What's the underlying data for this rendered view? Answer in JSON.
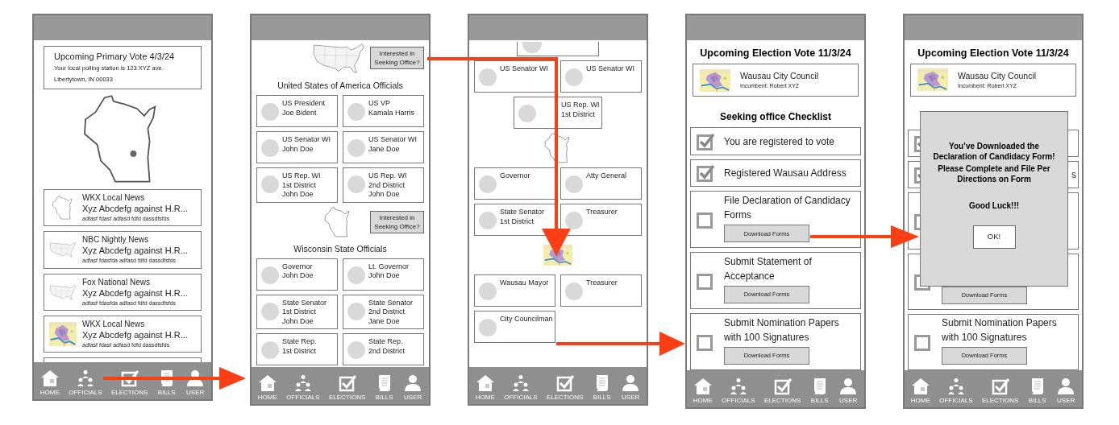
{
  "screens": [
    {
      "kind": "home",
      "blocks": [
        {
          "kind": "notice",
          "title": "Upcoming Primary Vote 4/3/24",
          "lines": [
            "Your local polling station is 123 XYZ ave.",
            "Libertytown, IN 00033"
          ]
        },
        {
          "kind": "state_map",
          "pin": true
        },
        {
          "kind": "state_news",
          "source": "WKX Local News",
          "headline": "Xyz Abcdefg against H.R...",
          "snippet": "adfasf fdasf adfasd fdfd dassdfsfds"
        },
        {
          "kind": "country_news",
          "source": "NBC Nightly News",
          "headline": "Xyz Abcdefg against H.R...",
          "snippet": "adfasf fdasfda adfasd fdfd dassdfsfds"
        },
        {
          "kind": "country_news",
          "source": "Fox National News",
          "headline": "Xyz Abcdefg against H.R...",
          "snippet": "adfasf fdasfda adfasd fdfd dassdfsfds"
        },
        {
          "kind": "city_news",
          "source": "WKX Local News",
          "headline": "Xyz Abcdefg against H.R...",
          "snippet": "adfasf fdasf adfasd fdfd dassdfsfds"
        },
        {
          "kind": "card_edge",
          "avatar": false
        }
      ],
      "nav": [
        "HOME",
        "OFFICIALS",
        "ELECTIONS",
        "BILLS",
        "USER"
      ]
    },
    {
      "kind": "officials",
      "blocks": [
        {
          "kind": "country_map",
          "button": "Interested in Seeking Office?"
        },
        {
          "kind": "heading",
          "text": "United States of America Officials"
        },
        {
          "kind": "officials",
          "cards": [
            {
              "lines": [
                "US President",
                "Joe Bident"
              ]
            },
            {
              "lines": [
                "US VP",
                "Kamala Harris"
              ]
            },
            {
              "lines": [
                "US Senator WI",
                "John Doe"
              ]
            },
            {
              "lines": [
                "US Senator WI",
                "Jane Doe"
              ]
            },
            {
              "lines": [
                "US Rep. WI",
                "1st District",
                "John Doe"
              ]
            },
            {
              "lines": [
                "US Rep. WI",
                "2nd District",
                "John Doe"
              ]
            }
          ]
        },
        {
          "kind": "state_map",
          "button": "Interested in Seeking Office?"
        },
        {
          "kind": "heading",
          "text": "Wisconsin State Officials"
        },
        {
          "kind": "officials",
          "cards": [
            {
              "lines": [
                "Governor",
                "John Doe"
              ]
            },
            {
              "lines": [
                "Lt. Governor",
                "John Doe"
              ]
            },
            {
              "lines": [
                "State Senator",
                "1st District",
                "John Doe"
              ]
            },
            {
              "lines": [
                "State Senator",
                "2nd District",
                "Jane Doe"
              ]
            },
            {
              "lines": [
                "State Rep.",
                "1st District"
              ]
            },
            {
              "lines": [
                "State Rep.",
                "2nd District"
              ]
            }
          ]
        }
      ],
      "nav": [
        "HOME",
        "OFFICIALS",
        "ELECTIONS",
        "BILLS",
        "USER"
      ]
    },
    {
      "kind": "officials",
      "blocks": [
        {
          "kind": "card_edge",
          "avatar": true
        },
        {
          "kind": "officials",
          "cards": [
            {
              "lines": [
                "US Senator WI"
              ]
            },
            {
              "lines": [
                "US Senator WI"
              ]
            }
          ]
        },
        {
          "kind": "officials_centered",
          "cards": [
            {
              "lines": [
                "US Rep. WI",
                "1st District"
              ]
            }
          ]
        },
        {
          "kind": "state_map"
        },
        {
          "kind": "officials",
          "cards": [
            {
              "lines": [
                "Governor"
              ]
            },
            {
              "lines": [
                "Atty General"
              ]
            },
            {
              "lines": [
                "State Senator",
                "1st District"
              ]
            },
            {
              "lines": [
                "Treasurer"
              ]
            }
          ]
        },
        {
          "kind": "city_map"
        },
        {
          "kind": "officials",
          "cards": [
            {
              "lines": [
                "Wausau Mayor"
              ]
            },
            {
              "lines": [
                "Treasurer"
              ]
            },
            {
              "lines": [
                "City Councilman"
              ]
            }
          ]
        }
      ],
      "nav": [
        "HOME",
        "OFFICIALS",
        "ELECTIONS",
        "BILLS",
        "USER"
      ]
    },
    {
      "kind": "checklist",
      "blocks": [
        {
          "kind": "title_heading",
          "text": "Upcoming Election Vote 11/3/24"
        },
        {
          "kind": "race",
          "title": "Wausau City Council",
          "subtitle": "Incumbent: Robert XYZ"
        },
        {
          "kind": "section_heading",
          "text": "Seeking office Checklist"
        },
        {
          "kind": "task",
          "checked": true,
          "text": "You are registered to vote"
        },
        {
          "kind": "task",
          "checked": true,
          "text": "Registered Wausau Address"
        },
        {
          "kind": "task_with_form",
          "checked": false,
          "text": "File Declaration of Candidacy Forms",
          "button": "Download Forms"
        },
        {
          "kind": "task_with_form",
          "checked": false,
          "text": "Submit Statement of Acceptance",
          "button": "Download Forms"
        },
        {
          "kind": "task_with_form",
          "checked": false,
          "text": "Submit Nomination Papers with 100 Signatures",
          "button": "Download Forms"
        }
      ],
      "nav": [
        "HOME",
        "OFFICIALS",
        "ELECTIONS",
        "BILLS",
        "USER"
      ]
    },
    {
      "kind": "checklist",
      "blocks": [
        {
          "kind": "title_heading",
          "text": "Upcoming Election Vote 11/3/24"
        },
        {
          "kind": "race",
          "title": "Wausau City Council",
          "subtitle": "Incumbent: Robert XYZ"
        },
        {
          "kind": "gap"
        },
        {
          "kind": "task",
          "checked": true
        },
        {
          "kind": "task_end_text",
          "checked": true,
          "text": "s"
        },
        {
          "kind": "task_with_form",
          "checked": false
        },
        {
          "kind": "task_with_form",
          "checked": false,
          "button": "Download Forms"
        },
        {
          "kind": "task_with_form",
          "checked": false,
          "text": "Submit Nomination Papers with 100 Signatures",
          "button": "Download Forms"
        }
      ],
      "dialog": {
        "lines": [
          "You’ve Downloaded the Declaration of Candidacy Form!",
          "Please Complete and File Per Directions on Form",
          "Good Luck!!!"
        ],
        "button": "OK!"
      },
      "nav": [
        "HOME",
        "OFFICIALS",
        "ELECTIONS",
        "BILLS",
        "USER"
      ]
    }
  ]
}
